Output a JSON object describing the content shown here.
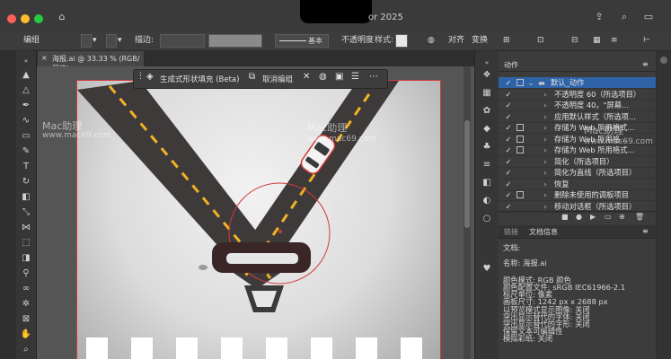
{
  "window": {
    "title_fragment": "or 2025",
    "traffic_lights": {
      "close": "#ff5f57",
      "minimize": "#febc2e",
      "maximize": "#28c840"
    }
  },
  "control_bar": {
    "mode_label": "编组",
    "stroke_label": "描边:",
    "stroke_style": "基本",
    "opacity_label": "不透明度",
    "style_label": "样式:",
    "align_label": "对齐",
    "transform_label": "变换"
  },
  "document_tab": {
    "close": "×",
    "name": "海报.ai @ 33.33 % (RGB/预览)"
  },
  "context_bar": {
    "generative_fill": "生成式形状填充 (Beta)",
    "ungroup": "取消编组"
  },
  "actions_panel": {
    "tab": "动作",
    "items": [
      {
        "label": "默认_动作",
        "level": 0,
        "selected": true,
        "has_square": true
      },
      {
        "label": "不透明度 60（所选项目）",
        "level": 1,
        "selected": false,
        "has_square": false
      },
      {
        "label": "不透明度 40，\"屏幕...",
        "level": 1,
        "selected": false,
        "has_square": false
      },
      {
        "label": "应用默认样式（所选项...",
        "level": 1,
        "selected": false,
        "has_square": false
      },
      {
        "label": "存储为 Web 所用格式...",
        "level": 1,
        "selected": false,
        "has_square": true
      },
      {
        "label": "存储为 Web 所用格...",
        "level": 1,
        "selected": false,
        "has_square": true
      },
      {
        "label": "存储为 Web 所用格式...",
        "level": 1,
        "selected": false,
        "has_square": true
      },
      {
        "label": "简化（所选项目）",
        "level": 1,
        "selected": false,
        "has_square": false
      },
      {
        "label": "简化为直线（所选项目）",
        "level": 1,
        "selected": false,
        "has_square": false
      },
      {
        "label": "恢复",
        "level": 1,
        "selected": false,
        "has_square": false
      },
      {
        "label": "删除未使用的调板项目",
        "level": 1,
        "selected": false,
        "has_square": true
      },
      {
        "label": "移动对话框（所选项目）",
        "level": 1,
        "selected": false,
        "has_square": false
      }
    ]
  },
  "info_panel": {
    "tabs": [
      "链接",
      "文档信息"
    ],
    "lines": [
      "文档:",
      "名称: 海报.ai",
      "颜色模式: RGB 颜色",
      "颜色配置文件: sRGB IEC61966-2.1",
      "标尺单位: 像素",
      "画板尺寸: 1242 px x 2688 px",
      "以预览模式显示图像: 关闭",
      "突出显示替代的字体: 关闭",
      "突出显示替代的字形: 关闭",
      "保留文本可编辑性",
      "模拟彩纸: 关闭"
    ]
  },
  "watermarks": [
    "Mac助理",
    "www.mac69.com",
    "Mac助理",
    "www.mac69.com",
    "Mac助理",
    "www.mac69.com"
  ]
}
